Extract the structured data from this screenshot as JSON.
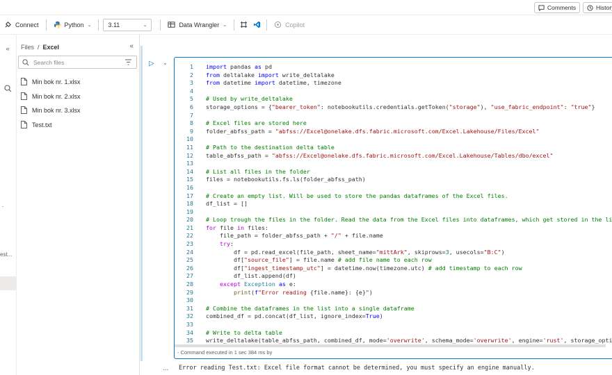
{
  "topbar": {
    "comments_label": "Comments",
    "history_label": "History"
  },
  "toolbar": {
    "connect_label": "Connect",
    "language_label": "Python",
    "version_value": "3.11",
    "data_wrangler_label": "Data Wrangler",
    "copilot_label": "Copilot"
  },
  "rail": {
    "truncated_text": "est..."
  },
  "explorer": {
    "breadcrumb_root": "Files",
    "breadcrumb_current": "Excel",
    "search_placeholder": "Search files",
    "files": [
      "Min bok nr. 1.xlsx",
      "Min bok nr. 2.xlsx",
      "Min bok nr. 3.xlsx",
      "Test.txt"
    ]
  },
  "cell": {
    "line_numbers": [
      "1",
      "2",
      "3",
      "4",
      "5",
      "6",
      "7",
      "8",
      "9",
      "10",
      "11",
      "12",
      "13",
      "14",
      "15",
      "16",
      "17",
      "18",
      "19",
      "20",
      "21",
      "22",
      "23",
      "24",
      "25",
      "26",
      "27",
      "28",
      "29",
      "30",
      "31",
      "32",
      "33",
      "34",
      "35"
    ],
    "exec_status": "- Command executed in 1 sec 384 ms by",
    "output_dots": "...",
    "output_text": "Error reading Test.txt: Excel file format cannot be determined, you must specify an engine manually."
  },
  "colors": {
    "accent": "#0078d4",
    "cell_border": "#0078d4",
    "keyword": "#0000ff",
    "string": "#a31515",
    "comment": "#008000"
  }
}
